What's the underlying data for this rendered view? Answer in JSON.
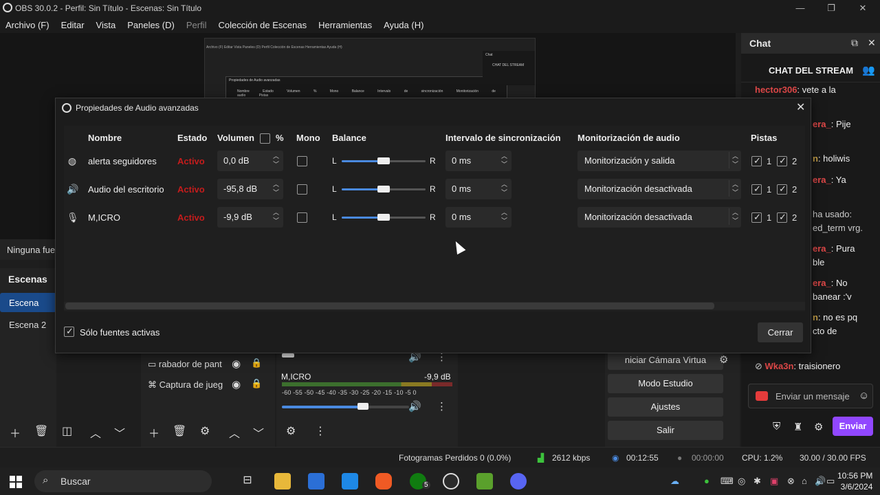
{
  "window": {
    "title": "OBS 30.0.2 - Perfil: Sin Título - Escenas: Sin Título"
  },
  "menu": [
    "Archivo (F)",
    "Editar",
    "Vista",
    "Paneles (D)",
    "Perfil",
    "Colección de Escenas",
    "Herramientas",
    "Ayuda (H)"
  ],
  "nested_preview": {
    "menu": "Archivo (F)   Editar   Vista   Paneles (D)   Perfil   Colección de Escenas   Herramientas   Ayuda (H)",
    "dialog_title": "Propiedades de Audio avanzadas",
    "dialog_headers": "Nombre Estado Volumen % Mono Balance Intervalo de sincronización Monitorización de audio Pistas",
    "chat_label": "Chat",
    "chat_stream": "CHAT DEL STREAM"
  },
  "chat": {
    "header": "Chat",
    "stream_title": "CHAT DEL STREAM",
    "messages": [
      {
        "user": "hector306",
        "text": ": vete a la"
      },
      {
        "user": "era_",
        "text": ": Pije"
      },
      {
        "user": "n",
        "text": ": holiwis"
      },
      {
        "user": "era_",
        "text": ": Ya"
      },
      {
        "user": "",
        "text": "ha usado:"
      },
      {
        "user": "",
        "text": "ed_term vrg."
      },
      {
        "user": "era_",
        "text": ": Pura"
      },
      {
        "user": "",
        "text": "ble"
      },
      {
        "user": "era_",
        "text": ": No"
      },
      {
        "user": "",
        "text": "banear :'v"
      },
      {
        "user": "n",
        "text": ": no es pq"
      },
      {
        "user": "",
        "text": "cto de"
      },
      {
        "user": "Wka3n",
        "text": ": traisionero"
      }
    ],
    "input_placeholder": "Enviar un mensaje",
    "send_label": "Enviar"
  },
  "sources_bar": {
    "text": "Ninguna fue"
  },
  "scenes": {
    "header": "Escenas",
    "items": [
      "Escena",
      "Escena 2"
    ]
  },
  "sources": {
    "items": [
      "rabador de pant",
      "Captura de jueg"
    ]
  },
  "mixer": {
    "channel": "M,ICRO",
    "db": "-9,9 dB",
    "ticks": "-60 -55 -50 -45 -40 -35 -30 -25 -20 -15 -10 -5 0",
    "level": 0.64
  },
  "controls": {
    "virtual_cam": "niciar Cámara Virtua",
    "studio": "Modo Estudio",
    "settings": "Ajustes",
    "exit": "Salir"
  },
  "status": {
    "dropped": "Fotogramas Perdidos 0 (0.0%)",
    "bitrate": "2612 kbps",
    "live_time": "00:12:55",
    "rec_time": "00:00:00",
    "cpu": "CPU: 1.2%",
    "fps": "30.00 / 30.00 FPS"
  },
  "taskbar": {
    "search": "Buscar",
    "time": "10:56 PM",
    "date": "3/6/2024",
    "xbox_badge": "5"
  },
  "dialog": {
    "title": "Propiedades de Audio avanzadas",
    "headers": {
      "name": "Nombre",
      "state": "Estado",
      "volume": "Volumen",
      "pct": "%",
      "mono": "Mono",
      "balance": "Balance",
      "sync": "Intervalo de sincronización",
      "monitor": "Monitorización de audio",
      "tracks": "Pistas"
    },
    "balance_l": "L",
    "balance_r": "R",
    "rows": [
      {
        "icon": "globe-icon",
        "name": "alerta seguidores",
        "state": "Activo",
        "volume": "0,0 dB",
        "mono": false,
        "balance": 0.5,
        "sync": "0 ms",
        "monitor": "Monitorización y salida",
        "track1": "1",
        "track2": "2"
      },
      {
        "icon": "speaker-icon",
        "name": "Audio del escritorio",
        "state": "Activo",
        "volume": "-95,8 dB",
        "mono": false,
        "balance": 0.5,
        "sync": "0 ms",
        "monitor": "Monitorización desactivada",
        "track1": "1",
        "track2": "2"
      },
      {
        "icon": "microphone-icon",
        "name": "M,ICRO",
        "state": "Activo",
        "volume": "-9,9 dB",
        "mono": false,
        "balance": 0.5,
        "sync": "0 ms",
        "monitor": "Monitorización desactivada",
        "track1": "1",
        "track2": "2"
      }
    ],
    "only_active": "Sólo fuentes activas",
    "close": "Cerrar"
  }
}
